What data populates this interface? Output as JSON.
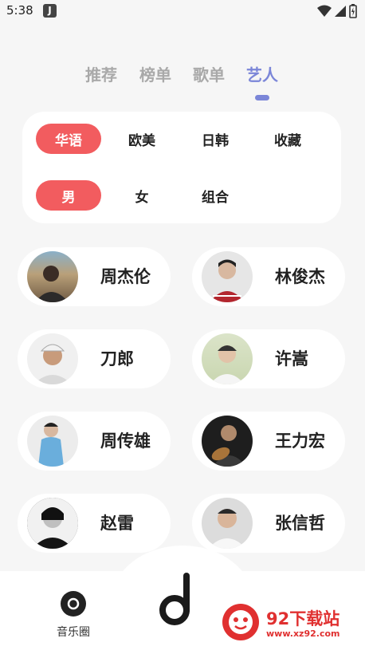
{
  "status_bar": {
    "time": "5:38",
    "app_badge": "J"
  },
  "tabs": [
    {
      "label": "推荐",
      "active": false
    },
    {
      "label": "榜单",
      "active": false
    },
    {
      "label": "歌单",
      "active": false
    },
    {
      "label": "艺人",
      "active": true
    }
  ],
  "filters": {
    "region": [
      {
        "label": "华语",
        "active": true
      },
      {
        "label": "欧美",
        "active": false
      },
      {
        "label": "日韩",
        "active": false
      },
      {
        "label": "收藏",
        "active": false
      }
    ],
    "gender": [
      {
        "label": "男",
        "active": true
      },
      {
        "label": "女",
        "active": false
      },
      {
        "label": "组合",
        "active": false
      }
    ]
  },
  "artists": [
    {
      "name": "周杰伦"
    },
    {
      "name": "林俊杰"
    },
    {
      "name": "刀郎"
    },
    {
      "name": "许嵩"
    },
    {
      "name": "周传雄"
    },
    {
      "name": "王力宏"
    },
    {
      "name": "赵雷"
    },
    {
      "name": "张信哲"
    }
  ],
  "bottom_nav": {
    "music_circle_label": "音乐圈",
    "center_icon": "music-note-logo"
  },
  "watermark": {
    "title": "92下载站",
    "url": "www.xz92.com"
  },
  "colors": {
    "accent": "#7b86d8",
    "chip_active": "#f25c5f",
    "watermark": "#e03030"
  }
}
